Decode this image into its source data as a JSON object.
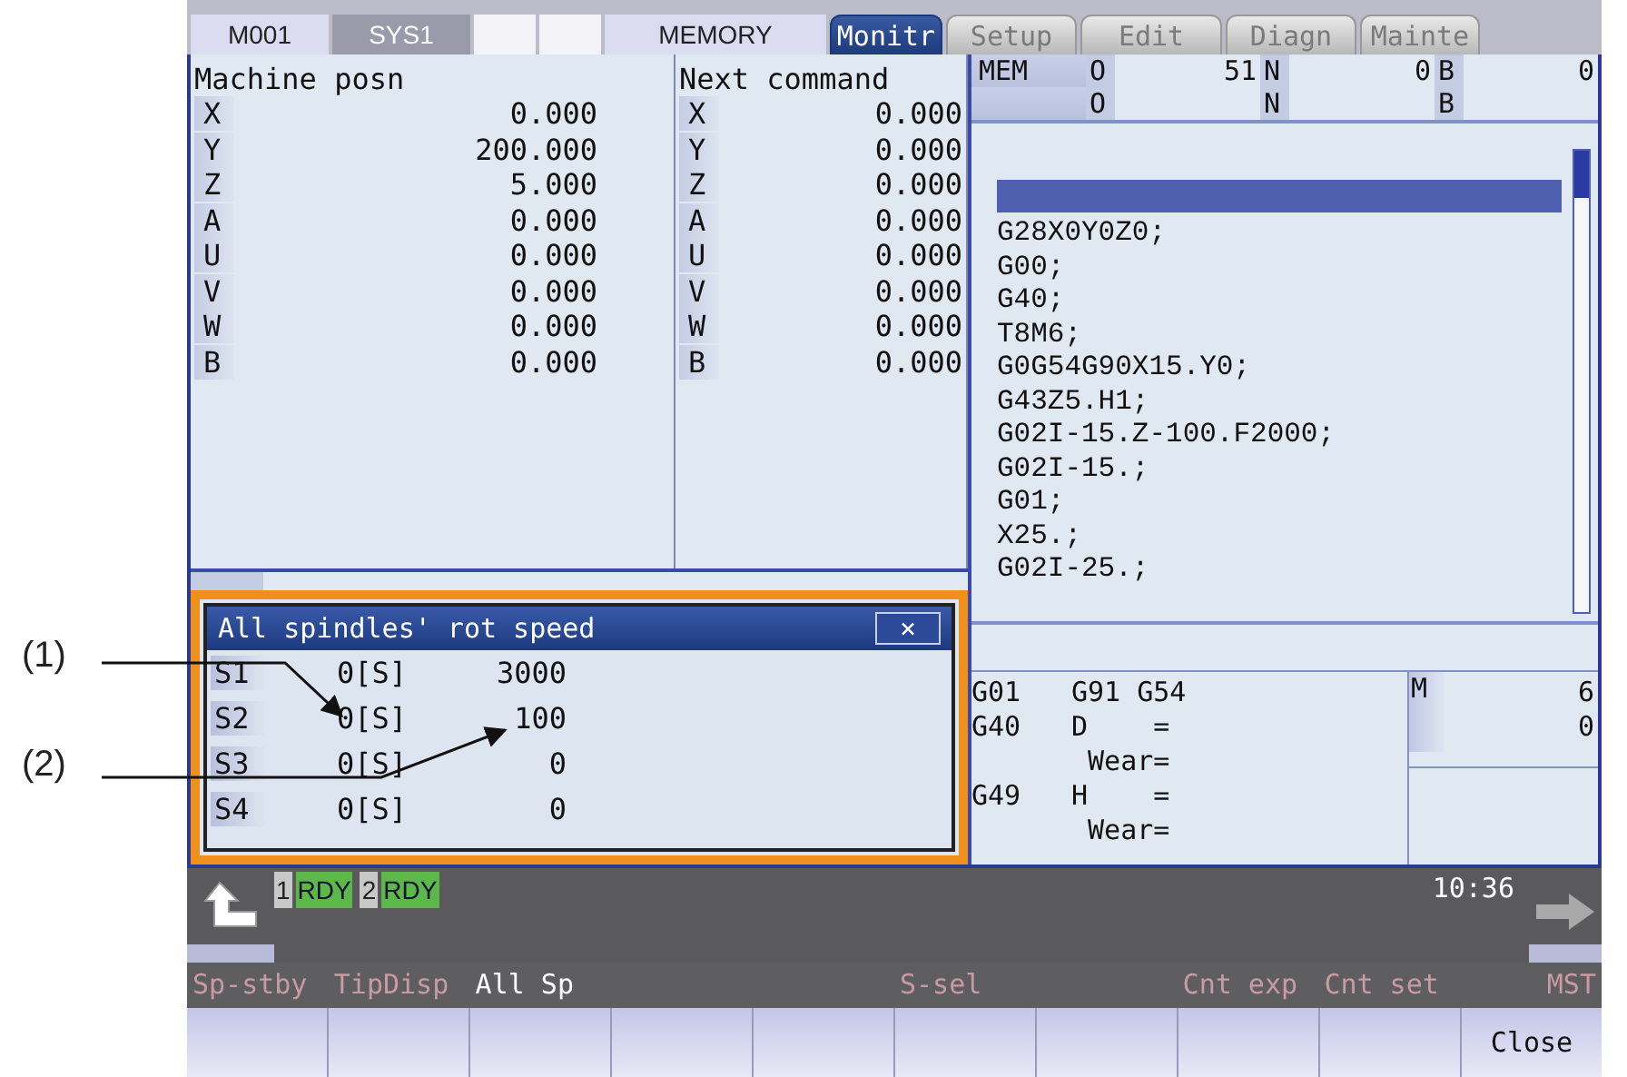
{
  "top_bar": {
    "items": [
      {
        "kind": "label",
        "text": "M001"
      },
      {
        "kind": "dark",
        "text": "SYS1"
      },
      {
        "kind": "blank"
      },
      {
        "kind": "blank"
      },
      {
        "kind": "label",
        "text": "MEMORY"
      }
    ],
    "tabs": [
      {
        "label": "Monitr",
        "selected": true
      },
      {
        "label": "Setup",
        "selected": false
      },
      {
        "label": "Edit",
        "selected": false
      },
      {
        "label": "Diagn",
        "selected": false
      },
      {
        "label": "Mainte",
        "selected": false
      }
    ]
  },
  "machine_position": {
    "title": "Machine posn",
    "axes": [
      {
        "axis": "X",
        "value": "0.000"
      },
      {
        "axis": "Y",
        "value": "200.000"
      },
      {
        "axis": "Z",
        "value": "5.000"
      },
      {
        "axis": "A",
        "value": "0.000"
      },
      {
        "axis": "U",
        "value": "0.000"
      },
      {
        "axis": "V",
        "value": "0.000"
      },
      {
        "axis": "W",
        "value": "0.000"
      },
      {
        "axis": "B",
        "value": "0.000"
      }
    ]
  },
  "next_command": {
    "title": "Next command",
    "axes": [
      {
        "axis": "X",
        "value": "0.000"
      },
      {
        "axis": "Y",
        "value": "0.000"
      },
      {
        "axis": "Z",
        "value": "0.000"
      },
      {
        "axis": "A",
        "value": "0.000"
      },
      {
        "axis": "U",
        "value": "0.000"
      },
      {
        "axis": "V",
        "value": "0.000"
      },
      {
        "axis": "W",
        "value": "0.000"
      },
      {
        "axis": "B",
        "value": "0.000"
      }
    ]
  },
  "program_header": [
    {
      "mode": "MEM",
      "fields": [
        {
          "label": "O",
          "value": "51"
        },
        {
          "label": "N",
          "value": "0"
        },
        {
          "label": "B",
          "value": "0"
        }
      ]
    },
    {
      "fields": [
        {
          "label": "O"
        },
        {
          "label": "N"
        },
        {
          "label": "B"
        }
      ]
    }
  ],
  "program": {
    "cursor_visible": true,
    "lines": [
      "G28X0Y0Z0;",
      "G00;",
      "G40;",
      "T8M6;",
      "G0G54G90X15.Y0;",
      "G43Z5.H1;",
      "G02I-15.Z-100.F2000;",
      "G02I-15.;",
      "G01;",
      "X25.;",
      "G02I-25.;"
    ]
  },
  "modal": {
    "rows": [
      {
        "code": "G01",
        "text": "G91 G54"
      },
      {
        "code": "G40",
        "text": "D    ="
      },
      {
        "text": " Wear="
      },
      {
        "code": "G49",
        "text": "H    ="
      },
      {
        "text": " Wear="
      }
    ]
  },
  "m_panel": {
    "label": "M",
    "values": [
      "6",
      "0"
    ]
  },
  "popup": {
    "title": "All spindles' rot speed",
    "close": "×",
    "rows": [
      {
        "spindle": "S1",
        "command": "0[S]",
        "speed": "3000"
      },
      {
        "spindle": "S2",
        "command": "0[S]",
        "speed": "100"
      },
      {
        "spindle": "S3",
        "command": "0[S]",
        "speed": "0"
      },
      {
        "spindle": "S4",
        "command": "0[S]",
        "speed": "0"
      }
    ]
  },
  "status": {
    "systems": [
      {
        "number": "1",
        "state": "RDY"
      },
      {
        "number": "2",
        "state": "RDY"
      }
    ],
    "time": "10:36"
  },
  "menu": [
    {
      "kind": "item",
      "label": "Sp-stby",
      "selected": false
    },
    {
      "kind": "item",
      "label": "TipDisp",
      "selected": false
    },
    {
      "kind": "item",
      "label": "All Sp",
      "selected": true
    },
    {
      "kind": "blank"
    },
    {
      "kind": "blank"
    },
    {
      "kind": "item",
      "label": "S-sel",
      "selected": false
    },
    {
      "kind": "blank"
    },
    {
      "kind": "item",
      "label": "Cnt exp",
      "selected": false
    },
    {
      "kind": "item",
      "label": "Cnt set",
      "selected": false
    },
    {
      "kind": "item",
      "label": "MST",
      "selected": false
    }
  ],
  "function_keys": [
    {
      "kind": "blank"
    },
    {
      "kind": "blank"
    },
    {
      "kind": "blank"
    },
    {
      "kind": "blank"
    },
    {
      "kind": "blank"
    },
    {
      "kind": "blank"
    },
    {
      "kind": "blank"
    },
    {
      "kind": "blank"
    },
    {
      "kind": "blank"
    },
    {
      "kind": "labeled",
      "label": "Close"
    }
  ],
  "callouts": [
    "(1)",
    "(2)"
  ]
}
